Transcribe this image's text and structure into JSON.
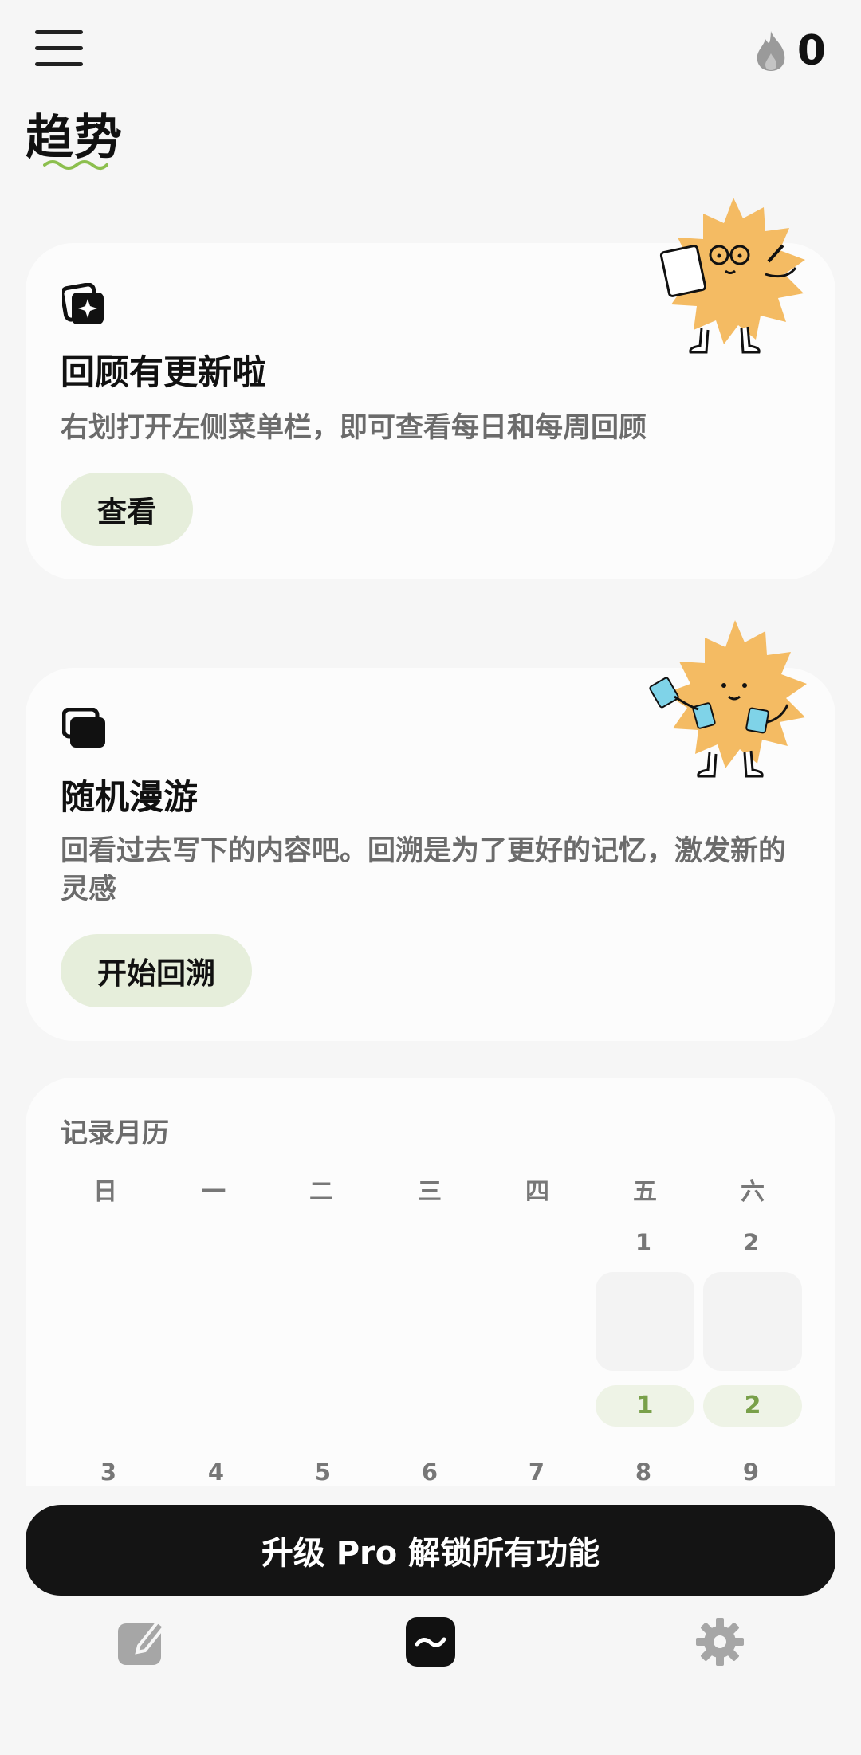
{
  "header": {
    "streak_count": "0",
    "title": "趋势"
  },
  "review_card": {
    "title": "回顾有更新啦",
    "description": "右划打开左侧菜单栏，即可查看每日和每周回顾",
    "button_label": "查看"
  },
  "random_card": {
    "title": "随机漫游",
    "description": "回看过去写下的内容吧。回溯是为了更好的记忆，激发新的灵感",
    "button_label": "开始回溯"
  },
  "calendar": {
    "title": "记录月历",
    "weekdays": [
      "日",
      "一",
      "二",
      "三",
      "四",
      "五",
      "六"
    ],
    "week1_days": [
      "1",
      "2"
    ],
    "week1_badges": [
      "1",
      "2"
    ],
    "week2_days": [
      "3",
      "4",
      "5",
      "6",
      "7",
      "8",
      "9"
    ]
  },
  "upgrade_label": "升级 Pro 解锁所有功能",
  "nav": {
    "items": [
      "compose-icon",
      "trends-icon",
      "settings-icon"
    ]
  },
  "colors": {
    "background": "#f6f6f6",
    "card": "#fcfcfc",
    "accent_green": "#79a04a",
    "pill_bg": "#e6eedb",
    "mascot": "#f4bb63",
    "upgrade_bg": "#141414"
  }
}
